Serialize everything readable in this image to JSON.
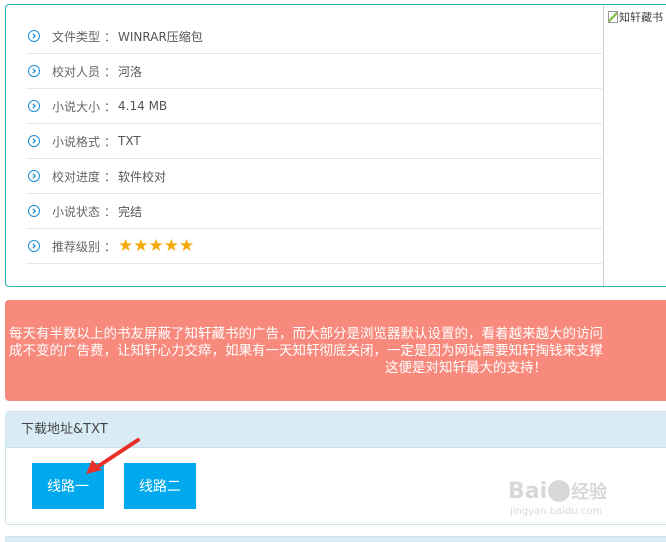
{
  "info": {
    "rows": [
      {
        "label": "文件类型",
        "sep": "：",
        "value": "WINRAR压缩包"
      },
      {
        "label": "校对人员",
        "sep": "：",
        "value": "河洛"
      },
      {
        "label": "小说大小",
        "sep": "：",
        "value": "4.14 MB"
      },
      {
        "label": "小说格式",
        "sep": "：",
        "value": "TXT"
      },
      {
        "label": "校对进度",
        "sep": "：",
        "value": "软件校对"
      },
      {
        "label": "小说状态",
        "sep": "：",
        "value": "完结"
      },
      {
        "label": "推荐级别",
        "sep": "：",
        "value": "★★★★★"
      }
    ],
    "rating": {
      "stars": 5,
      "max": 5
    },
    "cover_alt": "知轩藏书"
  },
  "notice": {
    "line1": "每天有半数以上的书友屏蔽了知轩藏书的广告，而大部分是浏览器默认设置的，看着越来越大的访问",
    "line2": "成不变的广告费，让知轩心力交瘁，如果有一天知轩彻底关闭，一定是因为网站需要知轩掏钱来支撑",
    "line3": "这便是对知轩最大的支持！"
  },
  "download": {
    "header": "下载地址&TXT",
    "button1": "线路一",
    "button2": "线路二"
  },
  "watermark": {
    "logo_left": "Bai",
    "logo_right": "经验",
    "url": "jingyan.baidu.com"
  },
  "colors": {
    "accent_border": "#2bb3b1",
    "icon_blue": "#1f8fd6",
    "star": "#f5a90a",
    "notice_bg": "#f88a7d",
    "button_bg": "#00a9ed",
    "header_bg": "#d9ecf6",
    "arrow": "#e8302a"
  }
}
